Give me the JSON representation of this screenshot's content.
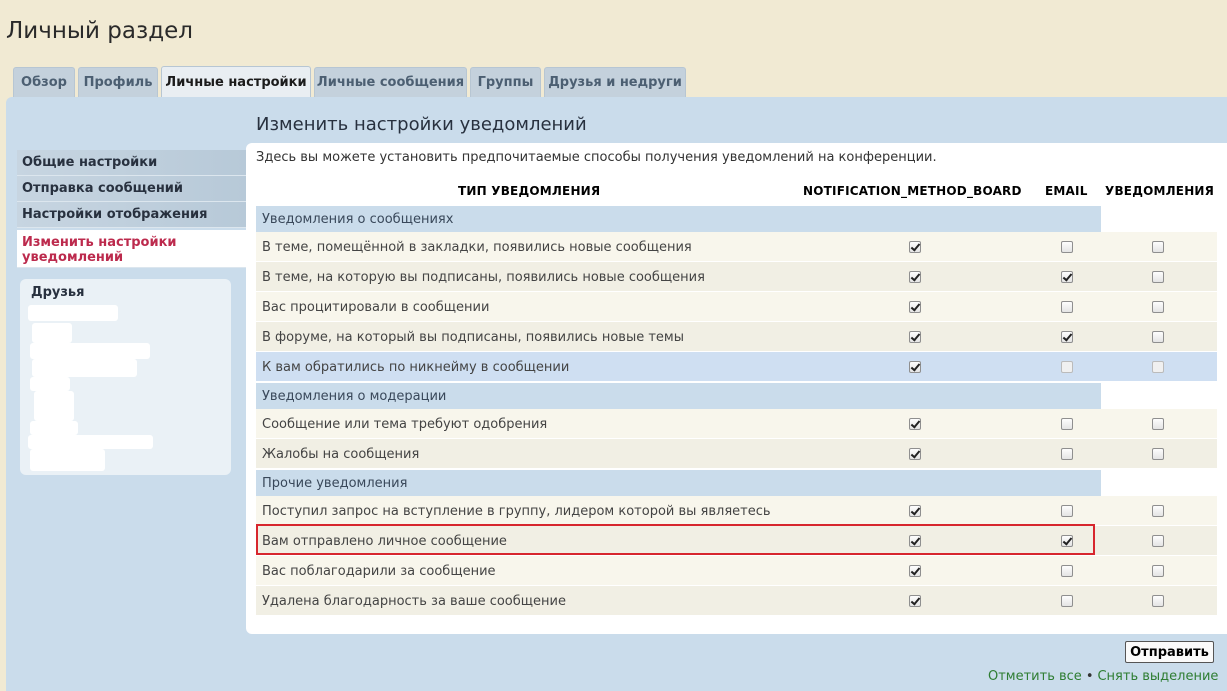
{
  "page_title": "Личный раздел",
  "tabs": [
    {
      "label": "Обзор",
      "active": false
    },
    {
      "label": "Профиль",
      "active": false
    },
    {
      "label": "Личные настройки",
      "active": true
    },
    {
      "label": "Личные сообщения",
      "active": false
    },
    {
      "label": "Группы",
      "active": false
    },
    {
      "label": "Друзья и недруги",
      "active": false
    }
  ],
  "sidebar": {
    "items": [
      {
        "label": "Общие настройки"
      },
      {
        "label": "Отправка сообщений"
      },
      {
        "label": "Настройки отображения"
      },
      {
        "label": "Изменить настройки уведомлений",
        "active": true
      }
    ],
    "friends_title": "Друзья"
  },
  "section_title": "Изменить настройки уведомлений",
  "intro": "Здесь вы можете установить предпочитаемые способы получения уведомлений на конференции.",
  "table": {
    "headers": [
      "ТИП УВЕДОМЛЕНИЯ",
      "NOTIFICATION_METHOD_BOARD",
      "EMAIL",
      "УВЕДОМЛЕНИЯ"
    ],
    "groups": [
      {
        "title": "Уведомления о сообщениях",
        "rows": [
          {
            "label": "В теме, помещённой в закладки, появились новые сообщения",
            "board": true,
            "email": false,
            "notify": false
          },
          {
            "label": "В теме, на которую вы подписаны, появились новые сообщения",
            "board": true,
            "email": true,
            "notify": false
          },
          {
            "label": "Вас процитировали в сообщении",
            "board": true,
            "email": false,
            "notify": false
          },
          {
            "label": "В форуме, на который вы подписаны, появились новые темы",
            "board": true,
            "email": true,
            "notify": false
          },
          {
            "label": "К вам обратились по никнейму в сообщении",
            "board": true,
            "email": false,
            "notify": false,
            "highlighted": true,
            "email_disabled": true
          }
        ]
      },
      {
        "title": "Уведомления о модерации",
        "rows": [
          {
            "label": "Сообщение или тема требуют одобрения",
            "board": true,
            "email": false,
            "notify": false
          },
          {
            "label": "Жалобы на сообщения",
            "board": true,
            "email": false,
            "notify": false
          }
        ]
      },
      {
        "title": "Прочие уведомления",
        "rows": [
          {
            "label": "Поступил запрос на вступление в группу, лидером которой вы являетесь",
            "board": true,
            "email": false,
            "notify": false
          },
          {
            "label": "Вам отправлено личное сообщение",
            "board": true,
            "email": true,
            "notify": false,
            "boxed": true
          },
          {
            "label": "Вас поблагодарили за сообщение",
            "board": true,
            "email": false,
            "notify": false
          },
          {
            "label": "Удалена благодарность за ваше сообщение",
            "board": true,
            "email": false,
            "notify": false
          }
        ]
      }
    ]
  },
  "submit_label": "Отправить",
  "footer": {
    "mark_all": "Отметить все",
    "separator": "•",
    "unmark_all": "Снять выделение"
  },
  "colors": {
    "background": "#f1ead3",
    "panel": "#cadceb",
    "active_sidebar_text": "#bc2a4d",
    "link_green": "#2e7d32",
    "highlight_box": "#d7262e"
  }
}
